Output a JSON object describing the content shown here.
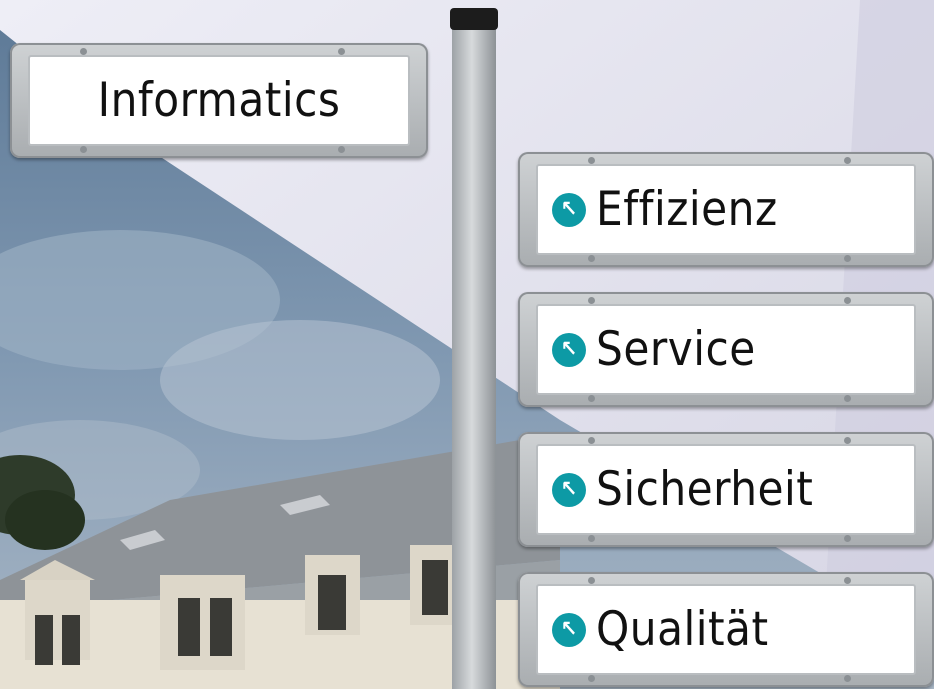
{
  "top_sign": {
    "label": "Informatics"
  },
  "signs": [
    {
      "label": "Effizienz"
    },
    {
      "label": "Service"
    },
    {
      "label": "Sicherheit"
    },
    {
      "label": "Qualität"
    }
  ],
  "colors": {
    "arrow_badge": "#0d9aa5",
    "sky": "#6f8aa6",
    "background_right": "#dcdce8"
  },
  "icons": {
    "sign_arrow": "arrow-up-left-icon"
  }
}
